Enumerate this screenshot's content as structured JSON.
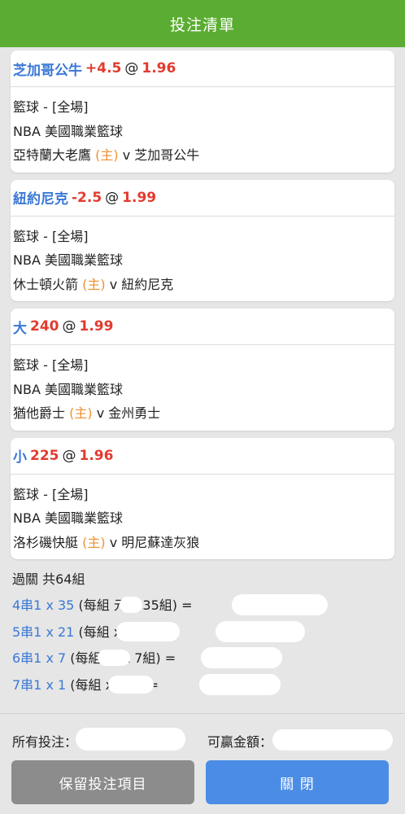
{
  "header": {
    "title": "投注清單"
  },
  "bets": [
    {
      "selection": "芝加哥公牛",
      "handicap": "+4.5",
      "at": "@",
      "odds": "1.96",
      "sport": "籃球 - [全場]",
      "league": "NBA 美國職業籃球",
      "home_team": "亞特蘭大老鷹",
      "home_mark": "(主)",
      "vs": "v",
      "away_team": "芝加哥公牛"
    },
    {
      "selection": "紐約尼克",
      "handicap": "-2.5",
      "at": "@",
      "odds": "1.99",
      "sport": "籃球 - [全場]",
      "league": "NBA 美國職業籃球",
      "home_team": "休士頓火箭",
      "home_mark": "(主)",
      "vs": "v",
      "away_team": "紐約尼克"
    },
    {
      "selection": "大",
      "handicap": "240",
      "at": "@",
      "odds": "1.99",
      "sport": "籃球 - [全場]",
      "league": "NBA 美國職業籃球",
      "home_team": "猶他爵士",
      "home_mark": "(主)",
      "vs": "v",
      "away_team": "金州勇士"
    },
    {
      "selection": "小",
      "handicap": "225",
      "at": "@",
      "odds": "1.96",
      "sport": "籃球 - [全場]",
      "league": "NBA 美國職業籃球",
      "home_team": "洛杉磯快艇",
      "home_mark": "(主)",
      "vs": "v",
      "away_team": "明尼蘇達灰狼"
    }
  ],
  "parlay": {
    "title": "過關 共64組",
    "combos": [
      {
        "type": "4串1 x 35",
        "text": " (每組    元 x 35組) ="
      },
      {
        "type": "5串1 x 21",
        "text": " (每組       x 21組) ="
      },
      {
        "type": "6串1 x 7",
        "text": " (每組    元 x 7組) ="
      },
      {
        "type": "7串1 x 1",
        "text": " (每組       x 1組) ="
      }
    ]
  },
  "totals": {
    "total_stake_label": "所有投注：",
    "potential_win_label": "可贏金額："
  },
  "buttons": {
    "keep_label": "保留投注項目",
    "close_label": "關 閉"
  },
  "colors": {
    "header_bg": "#5aad32",
    "selection_blue": "#3a78d6",
    "odds_red": "#e23b2f",
    "home_orange": "#f09030",
    "keep_btn": "#8c8c8c",
    "close_btn": "#4b8de6"
  }
}
